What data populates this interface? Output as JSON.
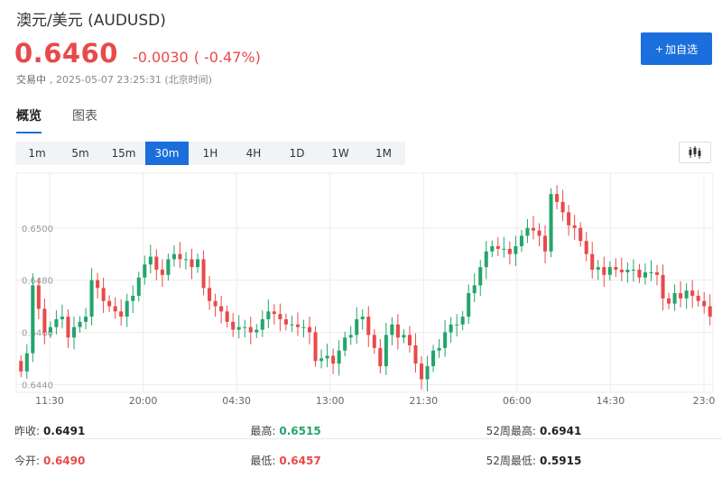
{
  "header": {
    "title": "澳元/美元 (AUDUSD)",
    "price": "0.6460",
    "change": "-0.0030",
    "change_pct": "( -0.47%)",
    "status": "交易中",
    "timestamp": ", 2025-05-07 23:25:31 (北京时间)",
    "add_button": "加自选",
    "add_button_icon": "plus-icon"
  },
  "tabs": [
    {
      "label": "概览",
      "active": true
    },
    {
      "label": "图表",
      "active": false
    }
  ],
  "intervals": [
    {
      "label": "1m",
      "active": false
    },
    {
      "label": "5m",
      "active": false
    },
    {
      "label": "15m",
      "active": false
    },
    {
      "label": "30m",
      "active": true
    },
    {
      "label": "1H",
      "active": false
    },
    {
      "label": "4H",
      "active": false
    },
    {
      "label": "1D",
      "active": false
    },
    {
      "label": "1W",
      "active": false
    },
    {
      "label": "1M",
      "active": false
    }
  ],
  "chart_type_icon": "candlestick-icon",
  "colors": {
    "up": "#23a56b",
    "down": "#e84a4a",
    "accent": "#1a6fdc",
    "grid": "#ececec"
  },
  "chart_data": {
    "type": "candlestick",
    "ylim": [
      0.6437,
      0.6521
    ],
    "y_ticks": [
      "0.6440",
      "0.6460",
      "0.6480",
      "0.6500"
    ],
    "x_tick_labels": [
      "11:30",
      "20:00",
      "04:30",
      "13:00",
      "21:30",
      "06:00",
      "14:30",
      "23:0"
    ],
    "grid": true,
    "closes": [
      0.6445,
      0.6452,
      0.6478,
      0.6469,
      0.646,
      0.6462,
      0.6465,
      0.6466,
      0.6458,
      0.6462,
      0.6464,
      0.6466,
      0.648,
      0.6477,
      0.6472,
      0.647,
      0.6468,
      0.6466,
      0.6472,
      0.6474,
      0.6481,
      0.6486,
      0.6489,
      0.6484,
      0.6482,
      0.6488,
      0.649,
      0.6488,
      0.6488,
      0.6485,
      0.6488,
      0.6477,
      0.6472,
      0.647,
      0.6468,
      0.6464,
      0.6461,
      0.6462,
      0.6462,
      0.646,
      0.6461,
      0.6465,
      0.6468,
      0.6467,
      0.6465,
      0.6463,
      0.6463,
      0.6462,
      0.6462,
      0.646,
      0.6449,
      0.645,
      0.6451,
      0.6448,
      0.6453,
      0.6458,
      0.6459,
      0.6465,
      0.6466,
      0.6459,
      0.6454,
      0.6447,
      0.6459,
      0.6463,
      0.6458,
      0.6459,
      0.6455,
      0.6448,
      0.6442,
      0.6447,
      0.6453,
      0.6454,
      0.646,
      0.6463,
      0.6463,
      0.6466,
      0.6475,
      0.6478,
      0.6485,
      0.6491,
      0.6493,
      0.6492,
      0.6492,
      0.649,
      0.6493,
      0.6497,
      0.65,
      0.6499,
      0.6497,
      0.6491,
      0.6513,
      0.651,
      0.6506,
      0.6501,
      0.65,
      0.6495,
      0.649,
      0.6484,
      0.6485,
      0.6482,
      0.6485,
      0.6484,
      0.6483,
      0.6484,
      0.6484,
      0.6481,
      0.6483,
      0.6483,
      0.6482,
      0.6473,
      0.6471,
      0.6475,
      0.6473,
      0.6476,
      0.6474,
      0.6472,
      0.647,
      0.6466
    ]
  },
  "stats": [
    [
      {
        "label": "昨收:",
        "value": "0.6491",
        "tone": "dark"
      },
      {
        "label": "最高:",
        "value": "0.6515",
        "tone": "green"
      },
      {
        "label": "52周最高:",
        "value": "0.6941",
        "tone": "dark"
      }
    ],
    [
      {
        "label": "今开:",
        "value": "0.6490",
        "tone": "red"
      },
      {
        "label": "最低:",
        "value": "0.6457",
        "tone": "red"
      },
      {
        "label": "52周最低:",
        "value": "0.5915",
        "tone": "dark"
      }
    ]
  ]
}
